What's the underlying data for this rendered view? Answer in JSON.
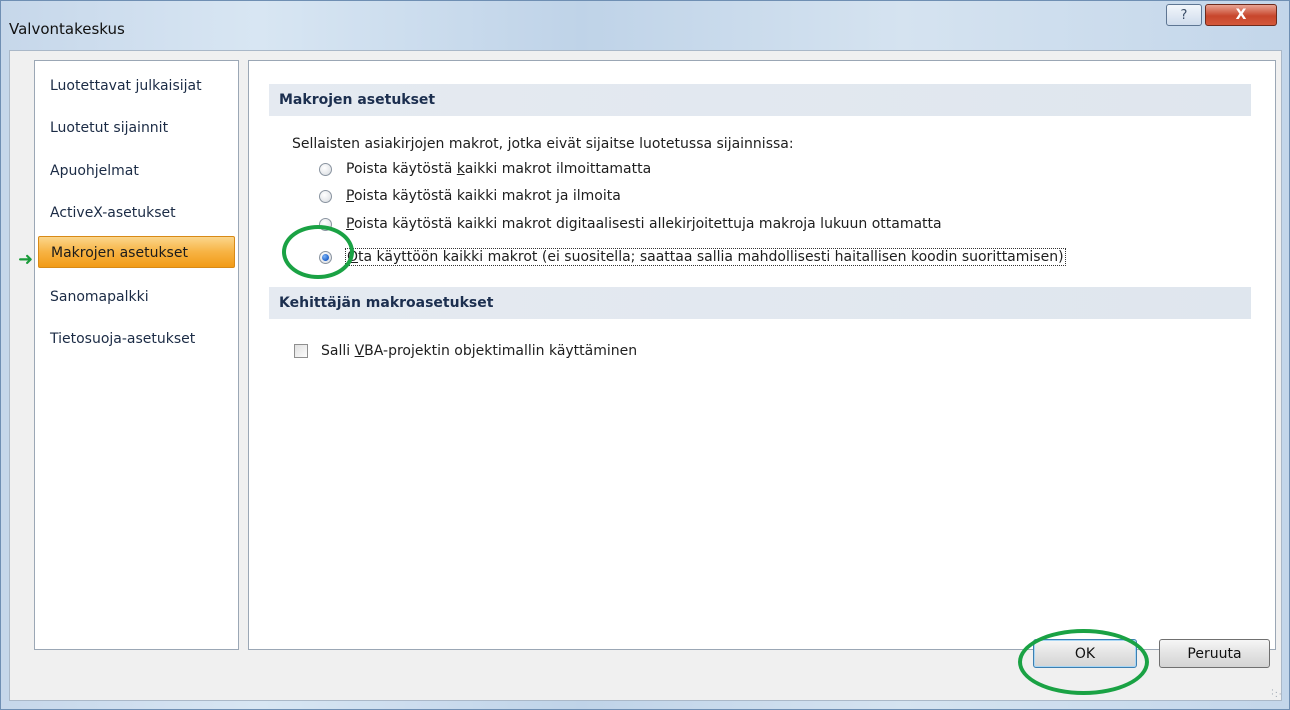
{
  "window": {
    "title": "Valvontakeskus",
    "help_symbol": "?",
    "close_symbol": "X"
  },
  "sidebar": {
    "items": [
      {
        "label": "Luotettavat julkaisijat"
      },
      {
        "label": "Luotetut sijainnit"
      },
      {
        "label": "Apuohjelmat"
      },
      {
        "label": "ActiveX-asetukset"
      },
      {
        "label": "Makrojen asetukset",
        "selected": true
      },
      {
        "label": "Sanomapalkki"
      },
      {
        "label": "Tietosuoja-asetukset"
      }
    ],
    "pointer_arrow": "➜"
  },
  "macro_settings": {
    "header": "Makrojen asetukset",
    "description": "Sellaisten asiakirjojen makrot, jotka eivät sijaitse luotetussa sijainnissa:",
    "options": [
      {
        "pre": "Poista käytöstä ",
        "ul": "k",
        "post": "aikki makrot ilmoittamatta",
        "checked": false
      },
      {
        "pre": "",
        "ul": "P",
        "post": "oista käytöstä kaikki makrot ja ilmoita",
        "checked": false
      },
      {
        "pre": "",
        "ul": "P",
        "post": "oista käytöstä kaikki makrot digitaalisesti allekirjoitettuja makroja lukuun ottamatta",
        "checked": false
      },
      {
        "pre": "",
        "ul": "O",
        "post": "ta käyttöön kaikki makrot (ei suositella; saattaa sallia mahdollisesti haitallisen koodin suorittamisen)",
        "checked": true
      }
    ]
  },
  "developer_settings": {
    "header": "Kehittäjän makroasetukset",
    "checkbox": {
      "pre": "Salli ",
      "ul": "V",
      "post": "BA-projektin objektimallin käyttäminen",
      "checked": false
    }
  },
  "buttons": {
    "ok": "OK",
    "cancel": "Peruuta"
  },
  "colors": {
    "selection": "#f7b343",
    "highlight_ring": "#1aa244"
  }
}
